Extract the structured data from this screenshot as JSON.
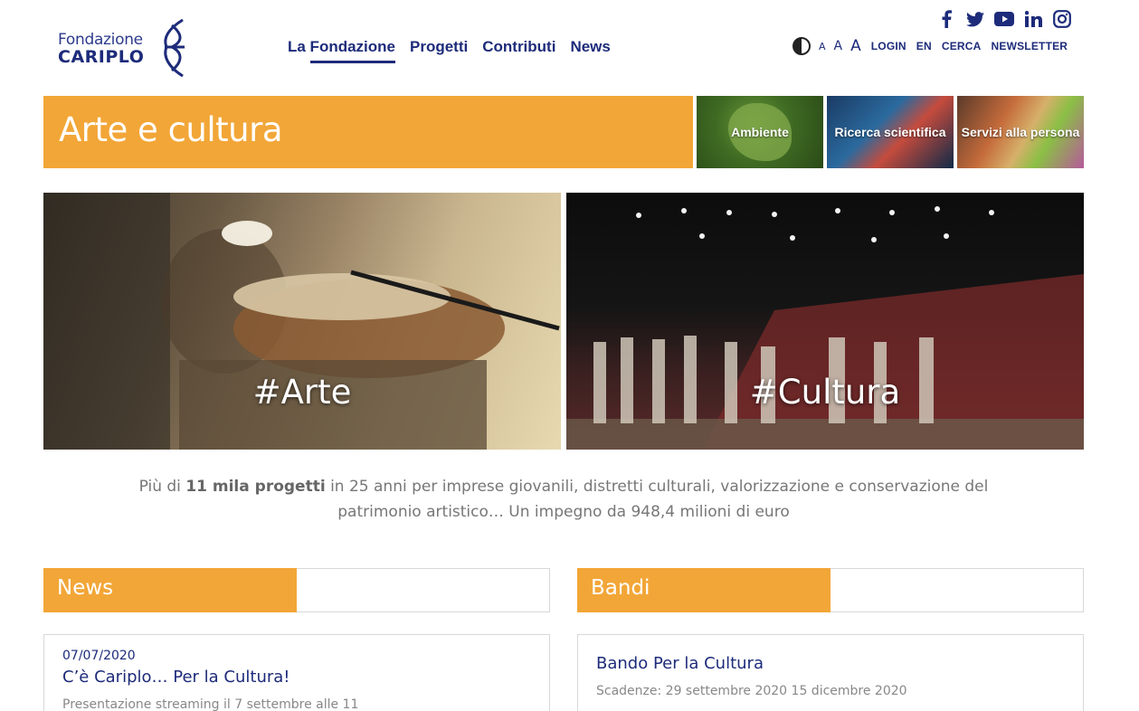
{
  "brand": {
    "line1": "Fondazione",
    "line2": "CARIPLO",
    "color": "#1d2b7a"
  },
  "nav": {
    "items": [
      {
        "label": "La Fondazione",
        "active": true
      },
      {
        "label": "Progetti",
        "active": false
      },
      {
        "label": "Contributi",
        "active": false
      },
      {
        "label": "News",
        "active": false
      }
    ]
  },
  "social": {
    "icons": [
      "facebook-icon",
      "twitter-icon",
      "youtube-icon",
      "linkedin-icon",
      "instagram-icon"
    ]
  },
  "util": {
    "font_small": "A",
    "font_medium": "A",
    "font_large": "A",
    "login": "LOGIN",
    "lang": "EN",
    "search": "CERCA",
    "newsletter": "NEWSLETTER"
  },
  "page": {
    "title": "Arte e cultura",
    "accent": "#f2a637"
  },
  "categories": [
    {
      "label": "Ambiente"
    },
    {
      "label": "Ricerca scientifica"
    },
    {
      "label": "Servizi alla persona"
    }
  ],
  "hero": {
    "left_label": "#Arte",
    "right_label": "#Cultura"
  },
  "description": {
    "prefix": "Più di ",
    "bold": "11 mila progetti",
    "rest": " in 25 anni per imprese giovanili, distretti culturali, valorizzazione e conservazione del patrimonio artistico… Un impegno da 948,4 milioni di euro"
  },
  "news": {
    "heading": "News",
    "item": {
      "date": "07/07/2020",
      "title": "C’è Cariplo… Per la Cultura!",
      "subtitle": "Presentazione streaming il 7 settembre alle 11"
    }
  },
  "bandi": {
    "heading": "Bandi",
    "item": {
      "title": "Bando Per la Cultura",
      "subtitle": "Scadenze: 29 settembre 2020 15 dicembre 2020"
    }
  }
}
